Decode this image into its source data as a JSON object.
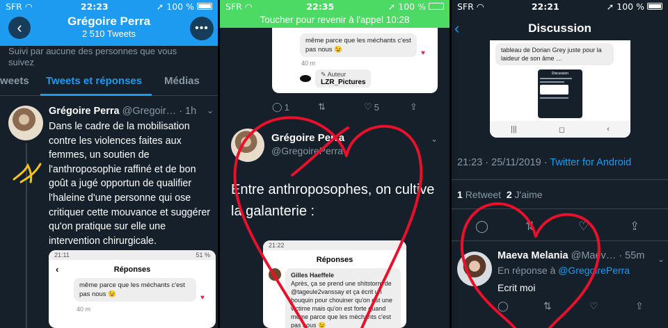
{
  "panel1": {
    "status": {
      "carrier": "SFR",
      "time": "22:23",
      "battery": "100 %"
    },
    "header": {
      "name": "Grégoire Perra",
      "count": "2 510 Tweets"
    },
    "follow_note": "Suivi par aucune des personnes que vous\nsuivez",
    "tabs": [
      "weets",
      "Tweets et réponses",
      "Médias"
    ],
    "tweet": {
      "name": "Grégoire Perra",
      "handle": "@Gregoir… · 1h",
      "text": "Dans le cadre de la mobilisation contre les violences faites aux femmes, un soutien de l'anthroposophie raffiné et de bon goût a jugé opportun de qualifier l'haleine d'une personne qui ose critiquer cette mouvance et suggérer qu'on pratique sur elle une intervention chirurgicale."
    },
    "embed": {
      "status_time": "21:11",
      "status_battery": "51 %",
      "title": "Réponses",
      "bubble": "même parce que les méchants c'est pas nous 😉",
      "age": "40 m"
    }
  },
  "panel2": {
    "status": {
      "carrier": "SFR",
      "time": "22:35",
      "battery": "100 %"
    },
    "call_banner": "Toucher pour revenir à l'appel 10:28",
    "embed_top": {
      "bubble": "même parce que les méchants c'est pas nous 😉",
      "age": "40 m",
      "author_tag": "Auteur",
      "author_name": "LZR_Pictures"
    },
    "actions": {
      "replies": "1",
      "likes": "5"
    },
    "tweet": {
      "name": "Grégoire Perra",
      "handle": "@GregoirePerra",
      "text": "Entre anthroposophes, on cultive la galanterie :"
    },
    "embed_bot": {
      "status_time": "21:22",
      "title": "Réponses",
      "author": "Gilles Haeffele",
      "bubble": "Après, ça se prend une shitstorm de @tageule2vanssay et ça écrit un bouquin pour chouiner qu'on est une victime mais qu'on est forte quand même parce que les méchants c'est pas nous 😉"
    }
  },
  "panel3": {
    "status": {
      "carrier": "SFR",
      "time": "22:21",
      "battery": "100 %"
    },
    "title": "Discussion",
    "embed": {
      "bubble": "tableau de Dorian Grey juste pour la laideur de son âme …",
      "inner_title": "Discussion"
    },
    "timestamp": "21:23 · 25/11/2019 · ",
    "source": "Twitter for Android",
    "stats": {
      "retweets": "1",
      "retweets_label": "Retweet",
      "likes": "2",
      "likes_label": "J'aime"
    },
    "reply": {
      "name": "Maeva Melania",
      "handle": "@Maev… · 55m",
      "reply_to_prefix": "En réponse à ",
      "reply_to": "@GregoirePerra",
      "text": "Ecrit moi"
    }
  },
  "colors": {
    "twitter_blue": "#1d9bf0",
    "dark_bg": "#15202b",
    "call_green": "#4cd964",
    "scribble_red": "#e8102a",
    "scribble_yellow": "#f5c518"
  }
}
